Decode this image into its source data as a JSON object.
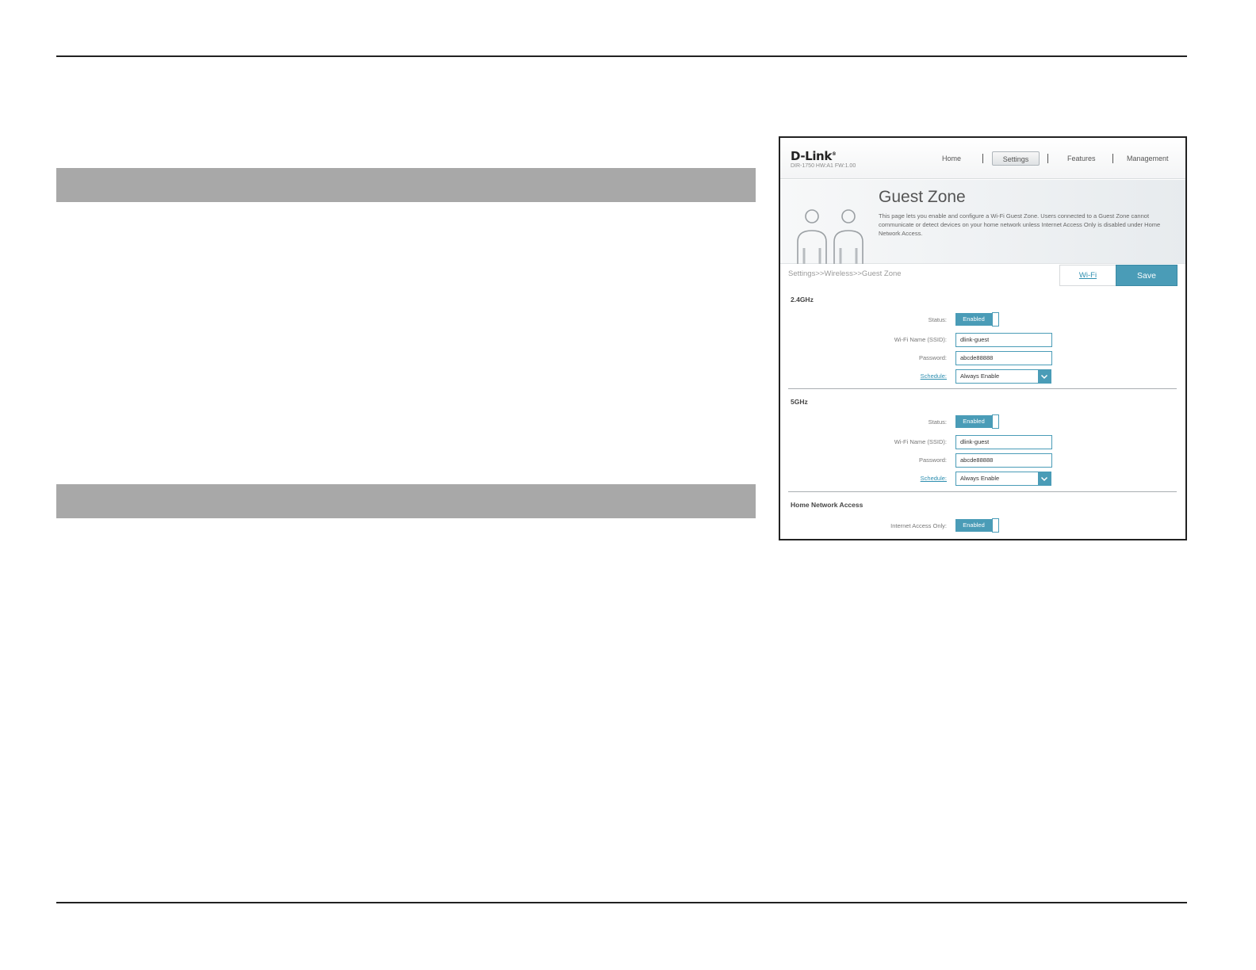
{
  "router_ui": {
    "brand": "D-Link",
    "model": "DIR-1750 HW:A1 FW:1.00",
    "nav": [
      {
        "label": "Home"
      },
      {
        "label": "Settings"
      },
      {
        "label": "Features"
      },
      {
        "label": "Management"
      }
    ],
    "page_title": "Guest Zone",
    "page_description": "This page lets you enable and configure a Wi-Fi Guest Zone. Users connected to a Guest Zone cannot communicate or detect devices on your home network unless Internet Access Only is disabled under Home Network Access.",
    "breadcrumb": "Settings>>Wireless>>Guest Zone",
    "wifi_tab": "Wi-Fi",
    "save_label": "Save",
    "band_24": {
      "heading": "2.4GHz",
      "status_label": "Status:",
      "status_value": "Enabled",
      "ssid_label": "Wi-Fi Name (SSID):",
      "ssid_value": "dlink-guest",
      "password_label": "Password:",
      "password_value": "abcde88888",
      "schedule_label": "Schedule:",
      "schedule_value": "Always Enable"
    },
    "band_5": {
      "heading": "5GHz",
      "status_label": "Status:",
      "status_value": "Enabled",
      "ssid_label": "Wi-Fi Name (SSID):",
      "ssid_value": "dlink-guest",
      "password_label": "Password:",
      "password_value": "abcde88888",
      "schedule_label": "Schedule:",
      "schedule_value": "Always Enable"
    },
    "home_network": {
      "heading": "Home Network Access",
      "internet_only_label": "Internet Access Only:",
      "internet_only_value": "Enabled"
    }
  },
  "colors": {
    "accent": "#4a9cb7",
    "bar_gray": "#a8a8a8",
    "rule": "#222222"
  },
  "icons": [
    "guest-people-icon",
    "chevron-down-icon"
  ]
}
